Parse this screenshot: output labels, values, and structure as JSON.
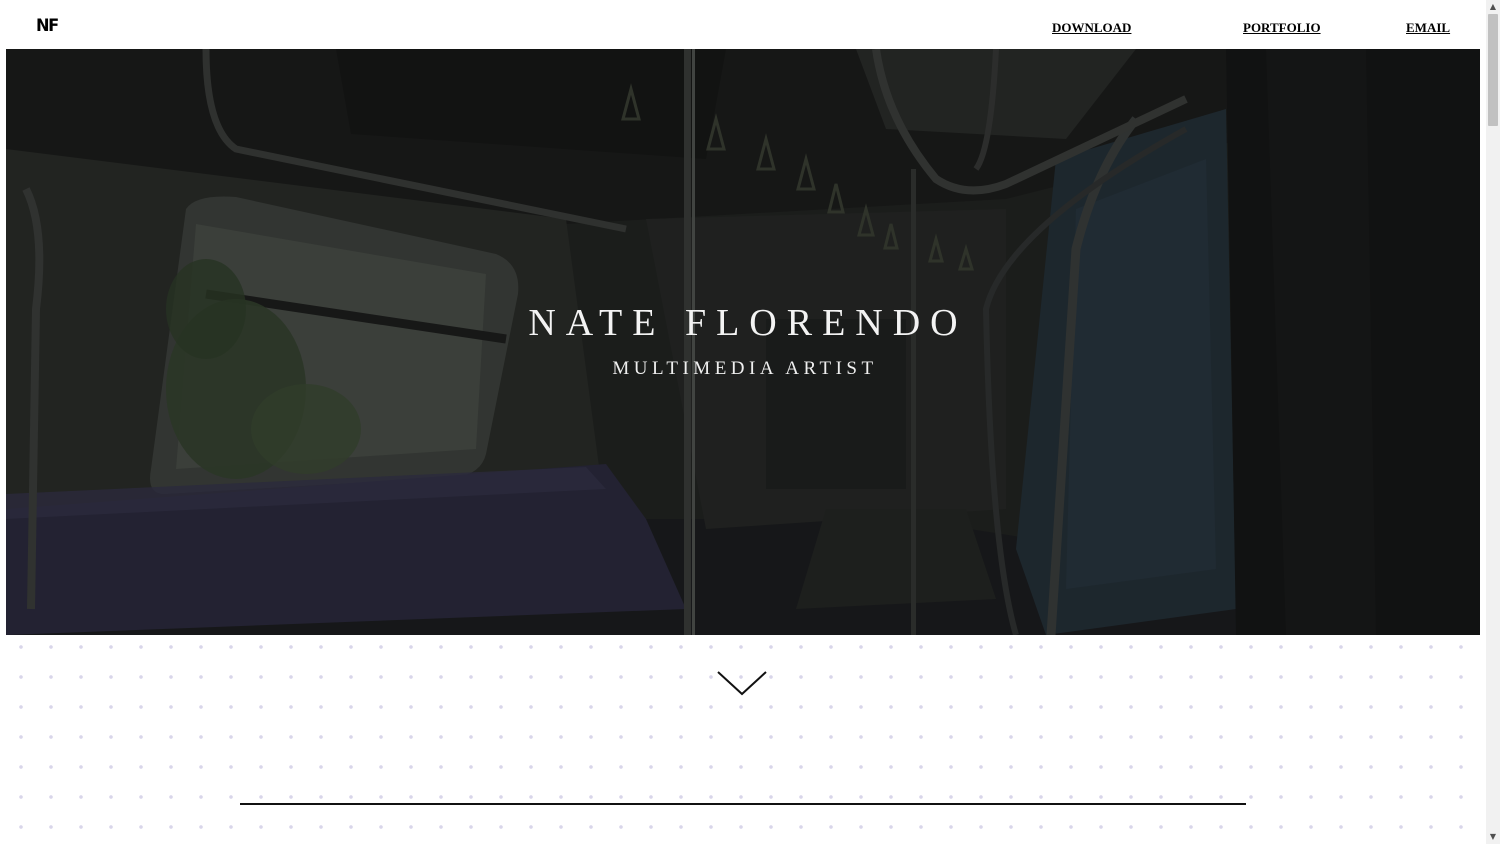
{
  "header": {
    "logo": "NF",
    "nav": [
      {
        "label": "DOWNLOAD"
      },
      {
        "label": "PORTFOLIO"
      },
      {
        "label": "EMAIL"
      }
    ]
  },
  "hero": {
    "title": "NATE FLORENDO",
    "subtitle": "MULTIMEDIA ARTIST",
    "background": "dark subway train interior illustration"
  },
  "scroll_indicator": {
    "icon": "chevron-down-icon"
  },
  "scrollbar": {
    "up_icon": "▲",
    "down_icon": "▼"
  },
  "colors": {
    "page_background": "#ffffff",
    "dot_pattern": "#d9d6ea",
    "hero_text": "#f3f3f3",
    "nav_text": "#000000"
  }
}
